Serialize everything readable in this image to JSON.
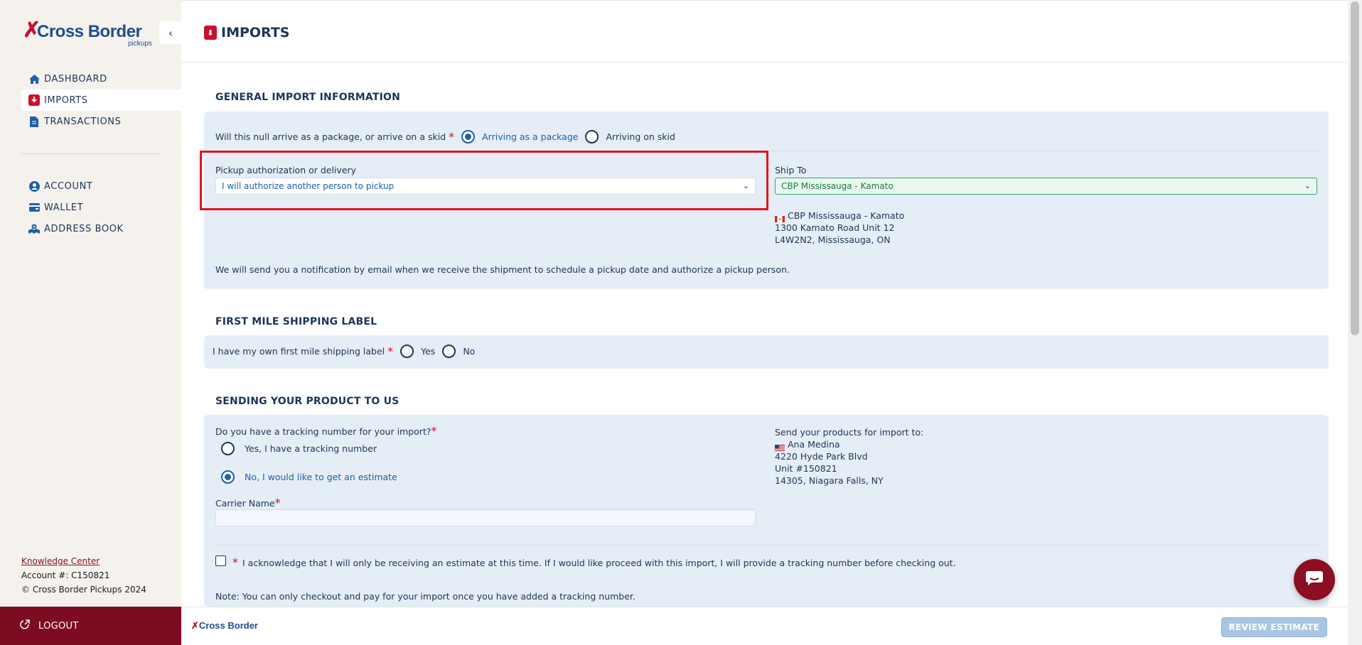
{
  "brand": {
    "name": "Cross Border",
    "sub": "pickups"
  },
  "sidebar": {
    "items": [
      {
        "label": "DASHBOARD",
        "icon": "home-icon"
      },
      {
        "label": "IMPORTS",
        "icon": "import-icon"
      },
      {
        "label": "TRANSACTIONS",
        "icon": "document-icon"
      }
    ],
    "account_items": [
      {
        "label": "ACCOUNT",
        "icon": "user-icon"
      },
      {
        "label": "WALLET",
        "icon": "wallet-icon"
      },
      {
        "label": "ADDRESS BOOK",
        "icon": "map-icon"
      }
    ],
    "knowledge_center": "Knowledge Center",
    "account_number": "Account #: C150821",
    "copyright": "© Cross Border Pickups 2024",
    "logout": "LOGOUT"
  },
  "header": {
    "title": "IMPORTS"
  },
  "general": {
    "title": "GENERAL IMPORT INFORMATION",
    "arrive_question": "Will this null arrive as a package, or arrive on a skid",
    "opt_package": "Arriving as a package",
    "opt_skid": "Arriving on skid",
    "pickup_label": "Pickup authorization or delivery",
    "pickup_value": "I will authorize another person to pickup",
    "ship_to_label": "Ship To",
    "ship_to_value": "CBP Mississauga - Kamato",
    "ship_addr_name": "CBP Mississauga - Kamato",
    "ship_addr_line1": "1300 Kamato Road Unit 12",
    "ship_addr_line2": "L4W2N2, Mississauga, ON",
    "notice": "We will send you a notification by email when we receive the shipment to schedule a pickup date and authorize a pickup person."
  },
  "first_mile": {
    "title": "FIRST MILE SHIPPING LABEL",
    "question": "I have my own first mile shipping label",
    "yes": "Yes",
    "no": "No"
  },
  "sending": {
    "title": "SENDING YOUR PRODUCT TO US",
    "tracking_question": "Do you have a tracking number for your import?",
    "opt_yes": "Yes, I have a tracking number",
    "opt_no": "No, I would like to get an estimate",
    "carrier_label": "Carrier Name",
    "send_to_label": "Send your products for import to:",
    "send_name": "Ana Medina",
    "send_line1": "4220 Hyde Park Blvd",
    "send_line2": "Unit #150821",
    "send_line3": "14305, Niagara Falls, NY",
    "acknowledge": "I acknowledge that I will only be receiving an estimate at this time. If I would like proceed with this import, I will provide a tracking number before checking out.",
    "note": "Note: You can only checkout and pay for your import once you have added a tracking number."
  },
  "footer": {
    "review_button": "REVIEW ESTIMATE",
    "mini_brand": "Cross Border"
  }
}
